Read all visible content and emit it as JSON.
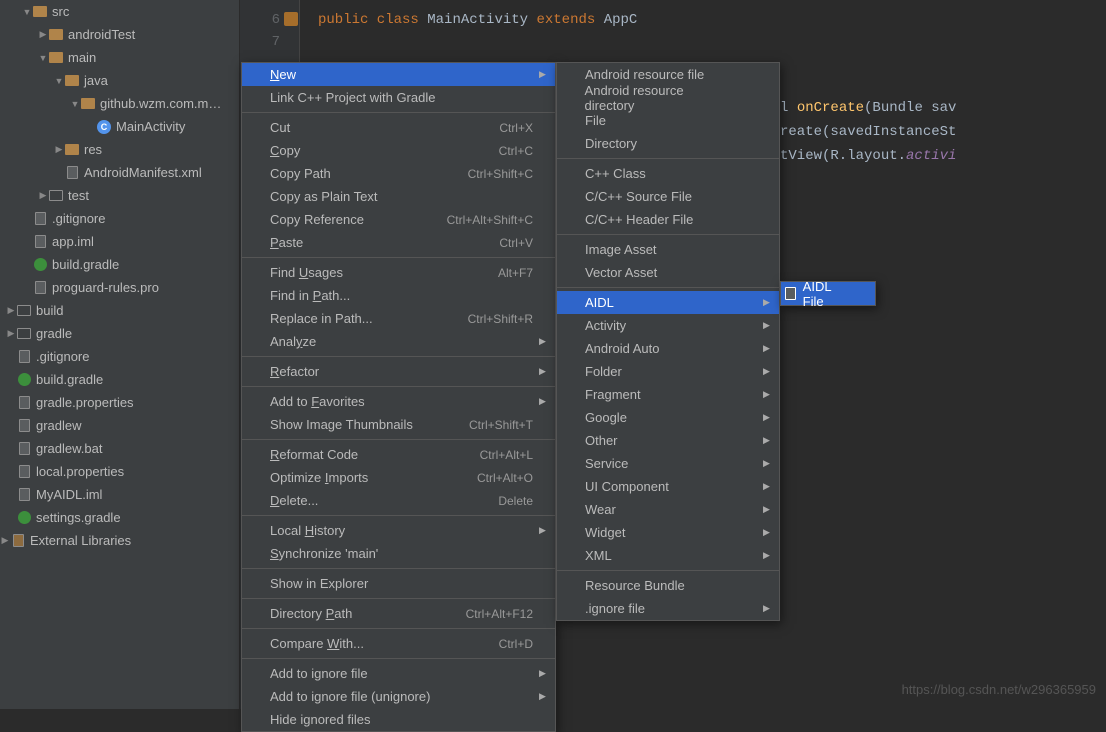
{
  "tree": {
    "items": [
      {
        "indent": 1,
        "arrow": "▼",
        "icon": "folder",
        "label": "src"
      },
      {
        "indent": 2,
        "arrow": "▶",
        "icon": "folder",
        "label": "androidTest"
      },
      {
        "indent": 2,
        "arrow": "▼",
        "icon": "folder",
        "label": "main"
      },
      {
        "indent": 3,
        "arrow": "▼",
        "icon": "folder",
        "label": "java"
      },
      {
        "indent": 4,
        "arrow": "▼",
        "icon": "folder",
        "label": "github.wzm.com.m…"
      },
      {
        "indent": 5,
        "arrow": " ",
        "icon": "class-c",
        "label": "MainActivity"
      },
      {
        "indent": 3,
        "arrow": "▶",
        "icon": "folder",
        "label": "res"
      },
      {
        "indent": 3,
        "arrow": " ",
        "icon": "file",
        "label": "AndroidManifest.xml"
      },
      {
        "indent": 2,
        "arrow": "▶",
        "icon": "folder2",
        "label": "test"
      },
      {
        "indent": 1,
        "arrow": " ",
        "icon": "file",
        "label": ".gitignore"
      },
      {
        "indent": 1,
        "arrow": " ",
        "icon": "file",
        "label": "app.iml"
      },
      {
        "indent": 1,
        "arrow": " ",
        "icon": "gradle",
        "label": "build.gradle"
      },
      {
        "indent": 1,
        "arrow": " ",
        "icon": "file",
        "label": "proguard-rules.pro"
      },
      {
        "indent": 0,
        "arrow": "▶",
        "icon": "folder2",
        "label": "build"
      },
      {
        "indent": 0,
        "arrow": "▶",
        "icon": "folder2",
        "label": "gradle"
      },
      {
        "indent": 0,
        "arrow": " ",
        "icon": "file",
        "label": ".gitignore"
      },
      {
        "indent": 0,
        "arrow": " ",
        "icon": "gradle",
        "label": "build.gradle"
      },
      {
        "indent": 0,
        "arrow": " ",
        "icon": "file",
        "label": "gradle.properties"
      },
      {
        "indent": 0,
        "arrow": " ",
        "icon": "file",
        "label": "gradlew"
      },
      {
        "indent": 0,
        "arrow": " ",
        "icon": "file",
        "label": "gradlew.bat"
      },
      {
        "indent": 0,
        "arrow": " ",
        "icon": "file",
        "label": "local.properties"
      },
      {
        "indent": 0,
        "arrow": " ",
        "icon": "file",
        "label": "MyAIDL.iml"
      },
      {
        "indent": 0,
        "arrow": " ",
        "icon": "gradle",
        "label": "settings.gradle"
      }
    ],
    "external": "External Libraries"
  },
  "editor": {
    "lines": {
      "l6": {
        "n": "6",
        "html": "<span class='kw'>public class</span> <span class='id'>MainActivity</span> <span class='kw'>extends</span> <span class='id'>AppC</span>"
      },
      "l7": {
        "n": "7",
        "html": ""
      },
      "l9a": {
        "html": "<span class='id'>l </span><span class='fn'>onCreate</span><span class='id'>(Bundle sav</span>"
      },
      "l9b": {
        "html": "<span class='id'>reate(savedInstanceSt</span>"
      },
      "l9c": {
        "html": "<span class='id'>tView(R.layout.</span><span class='it'>activi</span>"
      }
    }
  },
  "ctx_menu": {
    "items": [
      {
        "label": "New",
        "hl": true,
        "sub": true,
        "u": 0
      },
      {
        "label": "Link C++ Project with Gradle"
      },
      {
        "sep": true
      },
      {
        "label": "Cut",
        "shortcut": "Ctrl+X",
        "icon": "cut"
      },
      {
        "label": "Copy",
        "shortcut": "Ctrl+C",
        "icon": "copy",
        "u": 0
      },
      {
        "label": "Copy Path",
        "shortcut": "Ctrl+Shift+C"
      },
      {
        "label": "Copy as Plain Text"
      },
      {
        "label": "Copy Reference",
        "shortcut": "Ctrl+Alt+Shift+C"
      },
      {
        "label": "Paste",
        "shortcut": "Ctrl+V",
        "icon": "paste",
        "u": 0
      },
      {
        "sep": true
      },
      {
        "label": "Find Usages",
        "shortcut": "Alt+F7",
        "u": 5
      },
      {
        "label": "Find in Path...",
        "u": 8
      },
      {
        "label": "Replace in Path...",
        "shortcut": "Ctrl+Shift+R"
      },
      {
        "label": "Analyze",
        "sub": true,
        "u": 4
      },
      {
        "sep": true
      },
      {
        "label": "Refactor",
        "sub": true,
        "u": 0
      },
      {
        "sep": true
      },
      {
        "label": "Add to Favorites",
        "sub": true,
        "u": 7
      },
      {
        "label": "Show Image Thumbnails",
        "shortcut": "Ctrl+Shift+T"
      },
      {
        "sep": true
      },
      {
        "label": "Reformat Code",
        "shortcut": "Ctrl+Alt+L",
        "u": 0
      },
      {
        "label": "Optimize Imports",
        "shortcut": "Ctrl+Alt+O",
        "u": 9
      },
      {
        "label": "Delete...",
        "shortcut": "Delete",
        "u": 0
      },
      {
        "sep": true
      },
      {
        "label": "Local History",
        "sub": true,
        "u": 6
      },
      {
        "label": "Synchronize 'main'",
        "icon": "sync",
        "u": 0
      },
      {
        "sep": true
      },
      {
        "label": "Show in Explorer"
      },
      {
        "sep": true
      },
      {
        "label": "Directory Path",
        "shortcut": "Ctrl+Alt+F12",
        "u": 10
      },
      {
        "sep": true
      },
      {
        "label": "Compare With...",
        "shortcut": "Ctrl+D",
        "icon": "file",
        "u": 8
      },
      {
        "sep": true
      },
      {
        "label": "Add to ignore file",
        "sub": true
      },
      {
        "label": "Add to ignore file (unignore)",
        "sub": true
      },
      {
        "label": "Hide ignored files",
        "icon": "istar"
      }
    ]
  },
  "new_menu": {
    "items": [
      {
        "label": "Android resource file",
        "icon": "file"
      },
      {
        "label": "Android resource directory",
        "icon": "folder"
      },
      {
        "label": "File",
        "icon": "file"
      },
      {
        "label": "Directory",
        "icon": "folder"
      },
      {
        "sep": true
      },
      {
        "label": "C++ Class",
        "icon": "square-s"
      },
      {
        "label": "C/C++ Source File",
        "icon": "file"
      },
      {
        "label": "C/C++ Header File",
        "icon": "file"
      },
      {
        "sep": true
      },
      {
        "label": "Image Asset",
        "icon": "android"
      },
      {
        "label": "Vector Asset",
        "icon": "android"
      },
      {
        "sep": true
      },
      {
        "label": "AIDL",
        "icon": "android",
        "sub": true,
        "hl": true
      },
      {
        "label": "Activity",
        "icon": "android",
        "sub": true
      },
      {
        "label": "Android Auto",
        "icon": "android",
        "sub": true
      },
      {
        "label": "Folder",
        "icon": "android",
        "sub": true
      },
      {
        "label": "Fragment",
        "icon": "android",
        "sub": true
      },
      {
        "label": "Google",
        "icon": "android",
        "sub": true
      },
      {
        "label": "Other",
        "icon": "android",
        "sub": true
      },
      {
        "label": "Service",
        "icon": "android",
        "sub": true
      },
      {
        "label": "UI Component",
        "icon": "android",
        "sub": true
      },
      {
        "label": "Wear",
        "icon": "android",
        "sub": true
      },
      {
        "label": "Widget",
        "icon": "android",
        "sub": true
      },
      {
        "label": "XML",
        "icon": "android",
        "sub": true
      },
      {
        "sep": true
      },
      {
        "label": "Resource Bundle",
        "icon": "file"
      },
      {
        "label": ".ignore file",
        "icon": "istar",
        "sub": true
      }
    ]
  },
  "aidl_menu": {
    "label": "AIDL File"
  },
  "watermark": "https://blog.csdn.net/w296365959"
}
